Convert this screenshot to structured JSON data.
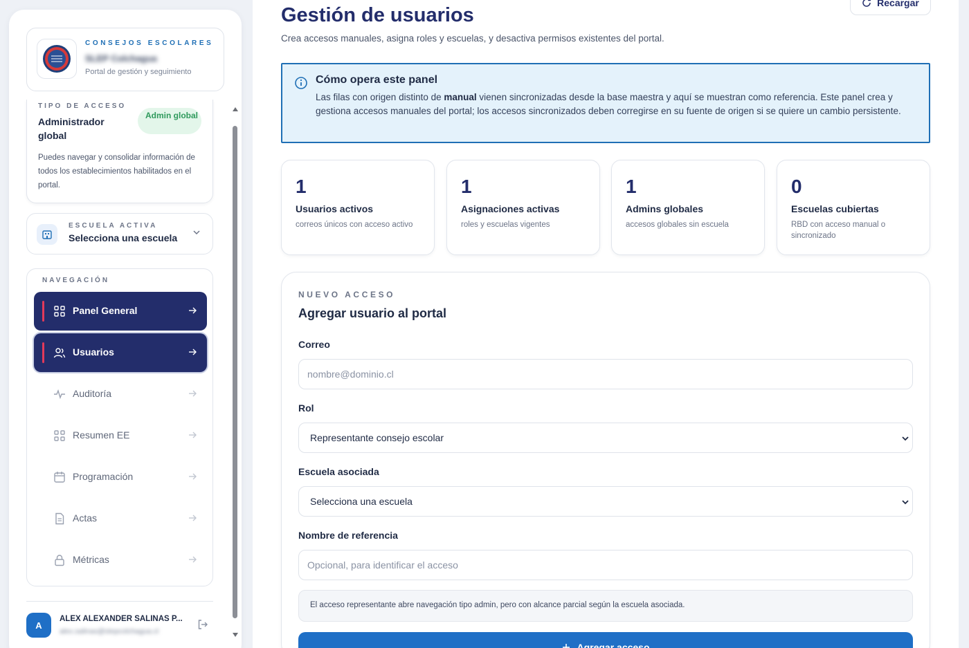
{
  "sidebar": {
    "brand": {
      "eyebrow": "CONSEJOS ESCOLARES",
      "name": "SLEP Colchagua",
      "subtitle": "Portal de gestión y seguimiento"
    },
    "access": {
      "eyebrow": "TIPO DE ACCESO",
      "title": "Administrador global",
      "badge": "Admin global",
      "description": "Puedes navegar y consolidar información de todos los establecimientos habilitados en el portal."
    },
    "school": {
      "eyebrow": "ESCUELA ACTIVA",
      "label": "Selecciona una escuela"
    },
    "nav": {
      "eyebrow": "NAVEGACIÓN",
      "items": [
        {
          "label": "Panel General",
          "icon": "grid-icon",
          "active": true
        },
        {
          "label": "Usuarios",
          "icon": "users-icon",
          "active": true
        },
        {
          "label": "Auditoría",
          "icon": "activity-icon",
          "active": false
        },
        {
          "label": "Resumen EE",
          "icon": "grid-icon",
          "active": false
        },
        {
          "label": "Programación",
          "icon": "calendar-icon",
          "active": false
        },
        {
          "label": "Actas",
          "icon": "document-icon",
          "active": false
        },
        {
          "label": "Métricas",
          "icon": "lock-icon",
          "active": false
        }
      ]
    },
    "user": {
      "initial": "A",
      "name": "ALEX ALEXANDER SALINAS P...",
      "email": "alex.salinas@slepcolchagua.cl"
    }
  },
  "header": {
    "title": "Gestión de usuarios",
    "subtitle": "Crea accesos manuales, asigna roles y escuelas, y desactiva permisos existentes del portal.",
    "reload_label": "Recargar"
  },
  "info": {
    "title": "Cómo opera este panel",
    "text_before": "Las filas con origen distinto de ",
    "text_bold": "manual",
    "text_after": " vienen sincronizadas desde la base maestra y aquí se muestran como referencia. Este panel crea y gestiona accesos manuales del portal; los accesos sincronizados deben corregirse en su fuente de origen si se quiere un cambio persistente."
  },
  "stats": [
    {
      "value": "1",
      "label": "Usuarios activos",
      "description": "correos únicos con acceso activo"
    },
    {
      "value": "1",
      "label": "Asignaciones activas",
      "description": "roles y escuelas vigentes"
    },
    {
      "value": "1",
      "label": "Admins globales",
      "description": "accesos globales sin escuela"
    },
    {
      "value": "0",
      "label": "Escuelas cubiertas",
      "description": "RBD con acceso manual o sincronizado"
    }
  ],
  "form": {
    "eyebrow": "NUEVO ACCESO",
    "title": "Agregar usuario al portal",
    "email_label": "Correo",
    "email_placeholder": "nombre@dominio.cl",
    "role_label": "Rol",
    "role_value": "Representante consejo escolar",
    "school_label": "Escuela asociada",
    "school_value": "Selecciona una escuela",
    "reference_label": "Nombre de referencia",
    "reference_placeholder": "Opcional, para identificar el acceso",
    "hint": "El acceso representante abre navegación tipo admin, pero con alcance parcial según la escuela asociada.",
    "submit_label": "Agregar acceso"
  },
  "colors": {
    "navy": "#232d6b",
    "accent_blue": "#1f6fc6",
    "accent_red": "#e23a5a",
    "info_bg": "#e4f2fb",
    "badge_bg": "#e3f6ea",
    "badge_text": "#2f9a5c"
  }
}
